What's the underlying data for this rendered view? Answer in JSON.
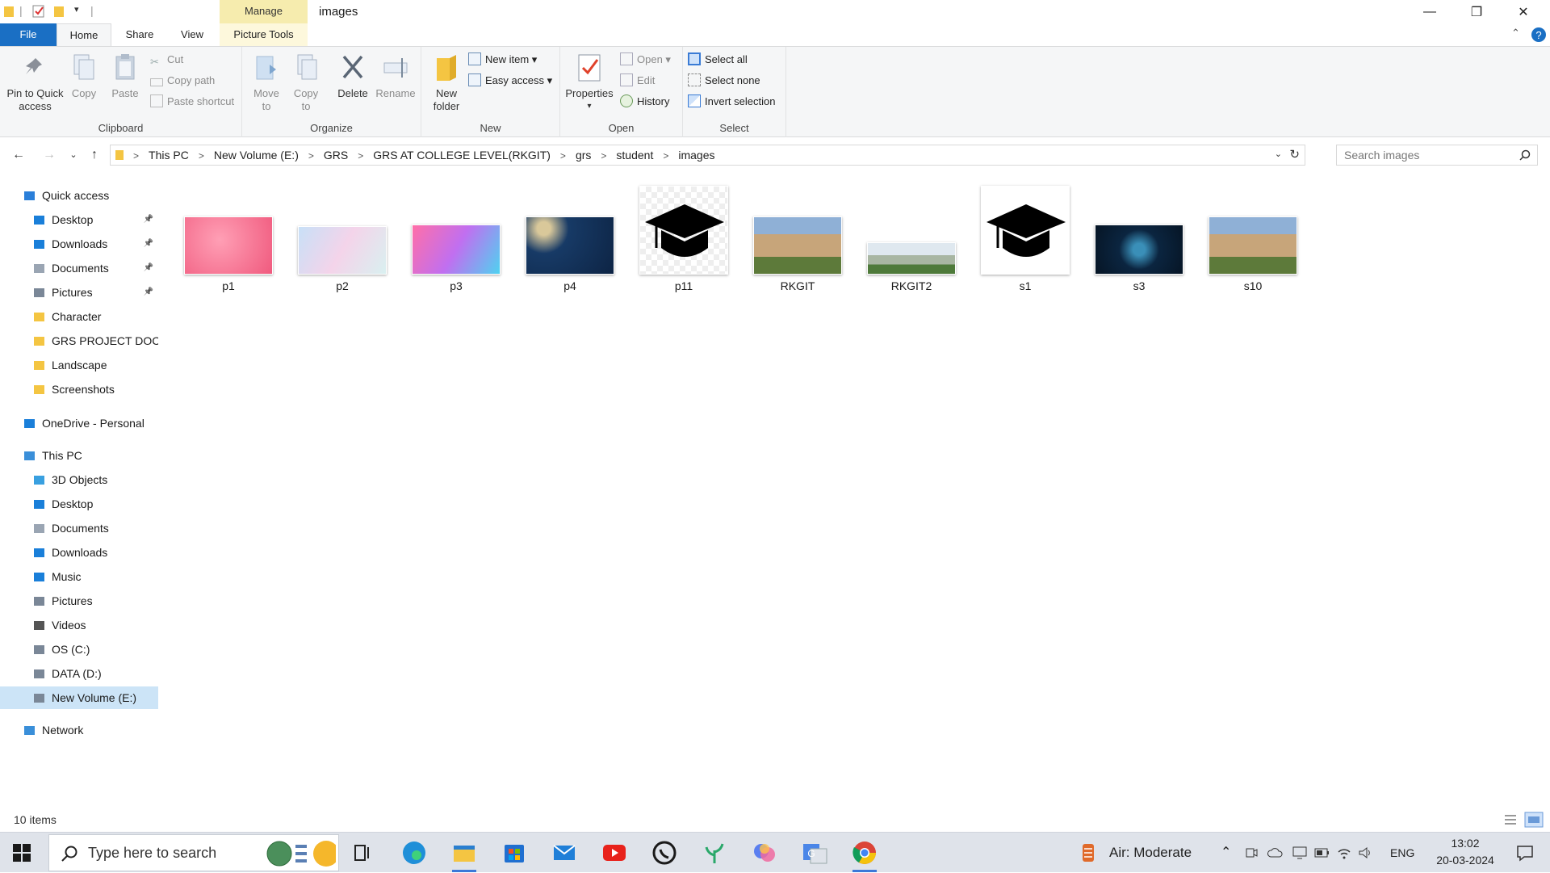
{
  "title_bar": {
    "manage_label": "Manage",
    "window_title": "images",
    "minimize": "—",
    "maximize": "❐",
    "close": "✕"
  },
  "ribbon_tabs": {
    "file": "File",
    "home": "Home",
    "share": "Share",
    "view": "View",
    "picture_tools": "Picture Tools"
  },
  "ribbon": {
    "clipboard": {
      "label": "Clipboard",
      "pin": "Pin to Quick access",
      "copy": "Copy",
      "paste": "Paste",
      "cut": "Cut",
      "copy_path": "Copy path",
      "paste_shortcut": "Paste shortcut"
    },
    "organize": {
      "label": "Organize",
      "move_to": "Move to",
      "copy_to": "Copy to",
      "delete": "Delete",
      "rename": "Rename"
    },
    "new": {
      "label": "New",
      "new_folder": "New folder",
      "new_item": "New item",
      "easy_access": "Easy access"
    },
    "open": {
      "label": "Open",
      "properties": "Properties",
      "open": "Open",
      "edit": "Edit",
      "history": "History"
    },
    "select": {
      "label": "Select",
      "select_all": "Select all",
      "select_none": "Select none",
      "invert": "Invert selection"
    }
  },
  "address": {
    "crumbs": [
      "This PC",
      "New Volume (E:)",
      "GRS",
      "GRS AT COLLEGE LEVEL(RKGIT)",
      "grs",
      "student",
      "images"
    ],
    "search_placeholder": "Search images"
  },
  "nav_pane": {
    "quick_access": "Quick access",
    "quick_items": [
      "Desktop",
      "Downloads",
      "Documents",
      "Pictures",
      "Character",
      "GRS PROJECT DOCUMENTS",
      "Landscape",
      "Screenshots"
    ],
    "onedrive": "OneDrive - Personal",
    "this_pc": "This PC",
    "pc_items": [
      "3D Objects",
      "Desktop",
      "Documents",
      "Downloads",
      "Music",
      "Pictures",
      "Videos",
      "OS (C:)",
      "DATA (D:)",
      "New Volume (E:)"
    ],
    "network": "Network"
  },
  "files": [
    "p1",
    "p2",
    "p3",
    "p4",
    "p11",
    "RKGIT",
    "RKGIT2",
    "s1",
    "s3",
    "s10"
  ],
  "status": {
    "item_count": "10 items"
  },
  "taskbar": {
    "search_placeholder": "Type here to search",
    "weather": "Air: Moderate",
    "language": "ENG",
    "time": "13:02",
    "date": "20-03-2024"
  }
}
